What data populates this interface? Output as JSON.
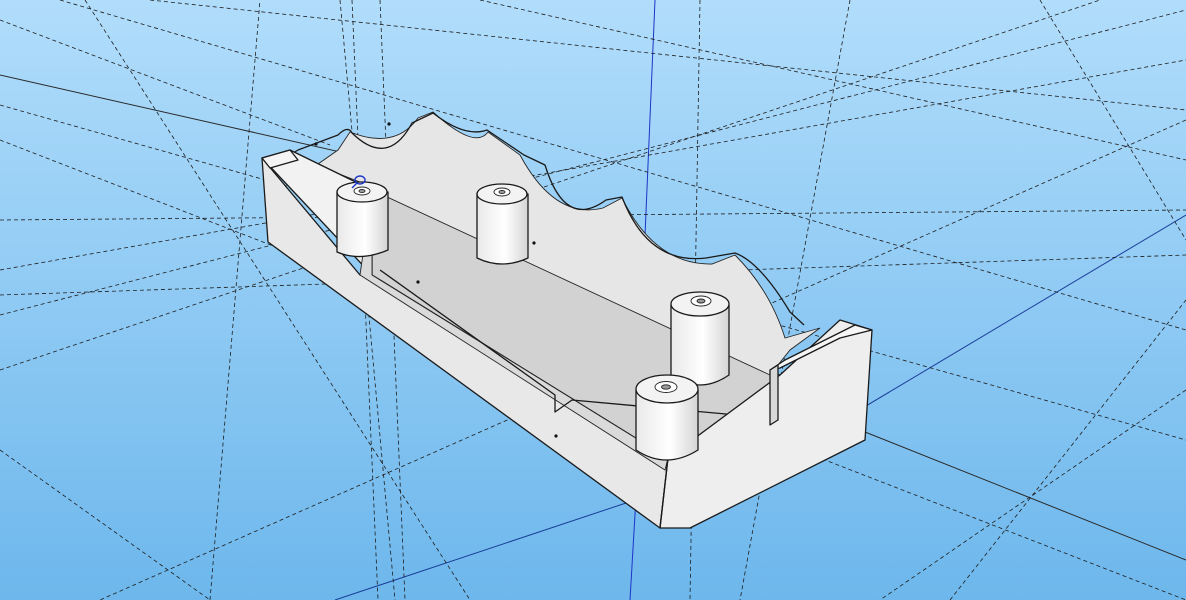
{
  "viewport": {
    "sky_top_color": "#b1ddfb",
    "sky_bottom_color": "#6db7ec",
    "face_light_color": "#f1f1f1",
    "face_mid_color": "#e2e2e2",
    "face_shade_color": "#c9c9c9",
    "floor_color": "#d2d2d2",
    "guide_color": "#1e1e1e",
    "axis_blue_color": "#1d34c8",
    "cursor_icon": "orbit-cursor-icon"
  }
}
